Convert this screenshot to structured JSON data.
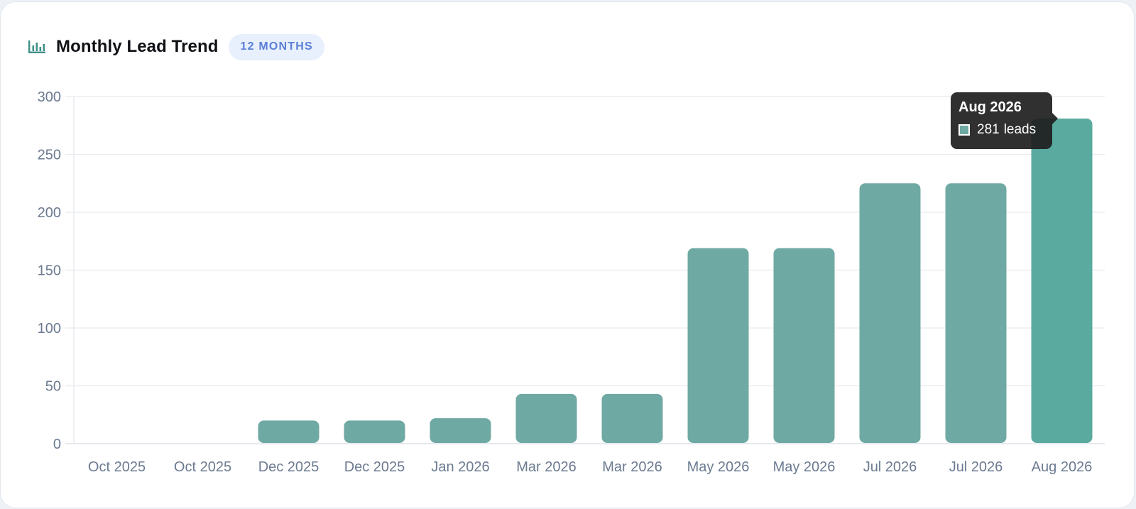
{
  "header": {
    "title": "Monthly Lead Trend",
    "icon": "bar-chart-icon",
    "badge": "12 MONTHS"
  },
  "colors": {
    "bar": "#6fa9a3",
    "bar_highlight": "#5aaa9f",
    "grid": "#e8ebef",
    "axis_text": "#6b7a90",
    "icon": "#3f8f86"
  },
  "tooltip": {
    "title": "Aug 2026",
    "value": "281",
    "unit": "leads"
  },
  "chart_data": {
    "type": "bar",
    "categories": [
      "Oct 2025",
      "Oct 2025",
      "Dec 2025",
      "Dec 2025",
      "Jan 2026",
      "Mar 2026",
      "Mar 2026",
      "May 2026",
      "May 2026",
      "Jul 2026",
      "Jul 2026",
      "Aug 2026"
    ],
    "values": [
      0,
      0,
      20,
      20,
      22,
      43,
      43,
      169,
      169,
      225,
      225,
      281
    ],
    "ylim": [
      0,
      300
    ],
    "yticks": [
      0,
      50,
      100,
      150,
      200,
      250,
      300
    ],
    "grid": true,
    "highlight_index": 11,
    "legend": "none"
  }
}
